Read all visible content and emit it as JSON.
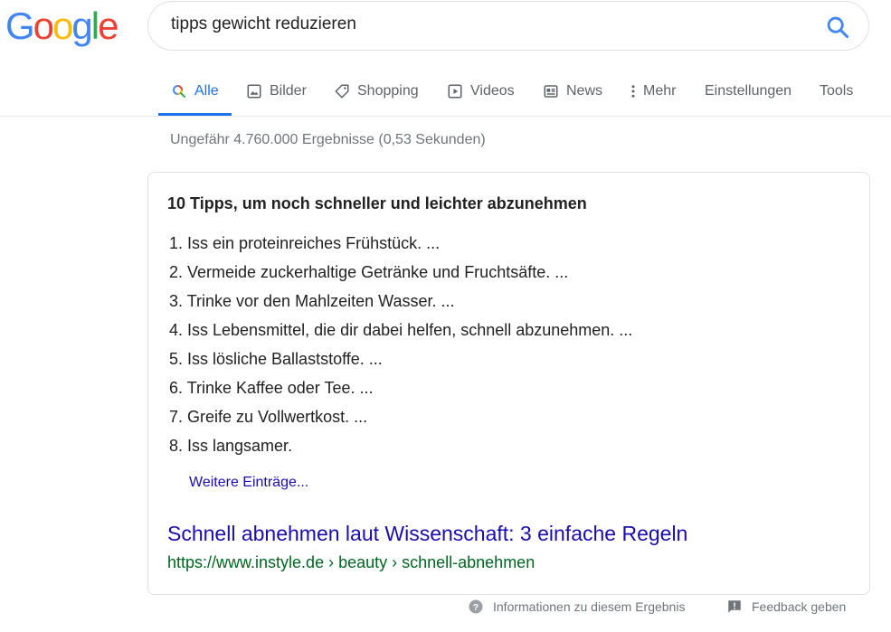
{
  "logo": {
    "letters": [
      "G",
      "o",
      "o",
      "g",
      "l",
      "e"
    ],
    "colors": [
      "#4285F4",
      "#EA4335",
      "#FBBC05",
      "#4285F4",
      "#34A853",
      "#EA4335"
    ]
  },
  "search": {
    "query": "tipps gewicht reduzieren",
    "icon": "search-icon"
  },
  "tabs": [
    {
      "label": "Alle",
      "icon": "search-icon",
      "active": true
    },
    {
      "label": "Bilder",
      "icon": "image-icon"
    },
    {
      "label": "Shopping",
      "icon": "tag-icon"
    },
    {
      "label": "Videos",
      "icon": "play-icon"
    },
    {
      "label": "News",
      "icon": "newspaper-icon"
    },
    {
      "label": "Mehr",
      "icon": "more-vert-icon"
    },
    {
      "label": "Einstellungen"
    },
    {
      "label": "Tools"
    }
  ],
  "results_count": "Ungefähr 4.760.000 Ergebnisse (0,53 Sekunden)",
  "snippet": {
    "title": "10 Tipps, um noch schneller und leichter abzunehmen",
    "items": [
      "1. Iss ein proteinreiches Frühstück. ...",
      "2. Vermeide zuckerhaltige Getränke und Fruchtsäfte. ...",
      "3. Trinke vor den Mahlzeiten Wasser. ...",
      "4. Iss Lebensmittel, die dir dabei helfen, schnell abzunehmen. ...",
      "5. Iss lösliche Ballaststoffe. ...",
      "6. Trinke Kaffee oder Tee. ...",
      "7. Greife zu Vollwertkost. ...",
      "8. Iss langsamer."
    ],
    "more_label": "Weitere Einträge...",
    "result_title": "Schnell abnehmen laut Wissenschaft: 3 einfache Regeln",
    "result_url": "https://www.instyle.de › beauty › schnell-abnehmen"
  },
  "footer": {
    "info_label": "Informationen zu diesem Ergebnis",
    "feedback_label": "Feedback geben"
  },
  "colors": {
    "link": "#1a0dab",
    "url": "#006621",
    "accent": "#1a73e8"
  }
}
